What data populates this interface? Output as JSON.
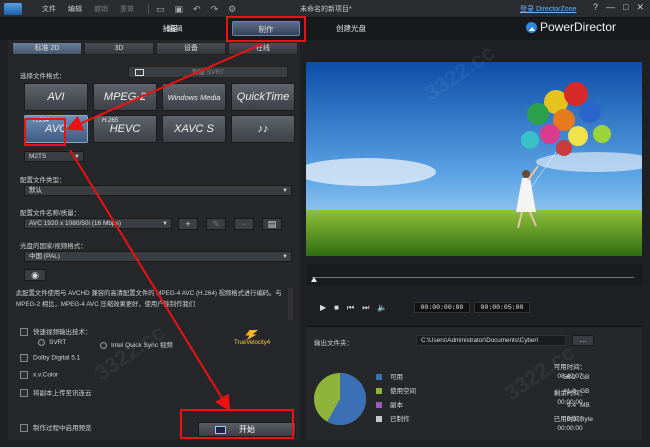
{
  "titlebar": {
    "menu": [
      {
        "label": "文件",
        "dim": false
      },
      {
        "label": "编辑",
        "dim": false
      },
      {
        "label": "撤销",
        "dim": true
      },
      {
        "label": "重做",
        "dim": true
      }
    ],
    "doc_title": "未命名的新项目*",
    "login": "登录 DirectorZone",
    "buttons": [
      "?",
      "—",
      "□",
      "✕"
    ]
  },
  "mode_tabs": [
    {
      "label": "捕捉",
      "active": false
    },
    {
      "label": "编辑",
      "active": false
    },
    {
      "label": "制作",
      "active": true
    },
    {
      "label": "创建光盘",
      "active": false
    }
  ],
  "brand": "PowerDirector",
  "left": {
    "subtabs": [
      {
        "label": "标准 2D",
        "active": true
      },
      {
        "label": "3D",
        "active": false
      },
      {
        "label": "设备",
        "active": false
      },
      {
        "label": "在线",
        "active": false
      }
    ],
    "choose_format_label": "选择文件格式：",
    "smart_svrt": "智能 SVRT",
    "formats": [
      {
        "label": "AVI",
        "sup": "",
        "selected": false,
        "small": false
      },
      {
        "label": "MPEG-2",
        "sup": "",
        "selected": false,
        "small": false
      },
      {
        "label": "Windows Media",
        "sup": "",
        "selected": false,
        "small": true
      },
      {
        "label": "QuickTime",
        "sup": "",
        "selected": false,
        "small": false
      },
      {
        "label": "AVC",
        "sup": "H.264",
        "selected": true,
        "small": false
      },
      {
        "label": "HEVC",
        "sup": "H.265",
        "selected": false,
        "small": false
      },
      {
        "label": "XAVC S",
        "sup": "",
        "selected": false,
        "small": false
      },
      {
        "label": "♪♪",
        "sup": "",
        "selected": false,
        "small": false
      }
    ],
    "container": "M2TS",
    "profile_type_label": "配置文件类型：",
    "profile_type": "默认",
    "profile_name_label": "配置文件名称/质量：",
    "profile_name": "AVC 1920 x 1080/50i (16 Mbps)",
    "profile_buttons": [
      "+",
      "✎",
      "−",
      "▤"
    ],
    "region_label": "光盘的国家/视频格式：",
    "region": "中国 (PAL)",
    "description": "此配置文件使用与 AVCHD 兼容的高清配置文件的 MPEG-4 AVC (H.264) 视频格式进行编码。与 MPEG-2 相比，MPEG-4 AVC 压缩效果更好，使用户能制作我们",
    "fast_render_label": "快速视频输出技术：",
    "svrt_label": "SVRT",
    "quick_sync_label": "Intel Quick Sync 视频",
    "truevelocity": "TrueVelocity4",
    "dolby_label": "Dolby Digital 5.1",
    "xvcolor_label": "x.v.Color",
    "upload_label": "将副本上传至讯连云",
    "preview_label": "制作过程中启用预览",
    "start_label": "开始"
  },
  "player": {
    "time_current": "00:00:00:00",
    "time_total": "00:00:05:00"
  },
  "info": {
    "output_folder_label": "输出文件夹：",
    "output_path": "C:\\Users\\Administrator\\Documents\\Cyberl",
    "browse_label": "...",
    "legend": [
      {
        "label": "可用",
        "value": "58.2",
        "unit": "GB",
        "color": "#3b6fb6"
      },
      {
        "label": "使用空间",
        "value": "41.8",
        "unit": "GB",
        "color": "#8fb43a"
      },
      {
        "label": "副本",
        "value": "9.4",
        "unit": "MB",
        "color": "#9b59c6"
      },
      {
        "label": "已制作",
        "value": "0.0",
        "unit": "Byte",
        "color": "#c8c8c8"
      }
    ],
    "disk_free_fraction": 0.582,
    "times": [
      {
        "label": "可用时间：",
        "value": "08:49:07"
      },
      {
        "label": "剩余时间：",
        "value": "00:00:00"
      },
      {
        "label": "已用时间：",
        "value": "00:00:00"
      }
    ]
  },
  "watermark": "3322.cc"
}
